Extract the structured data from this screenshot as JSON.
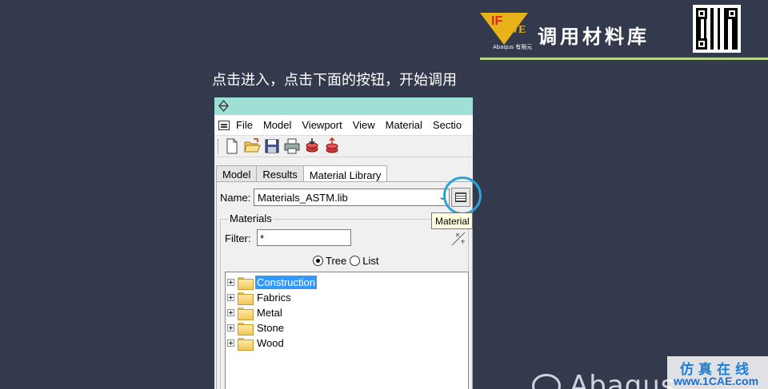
{
  "header": {
    "logo_text_1": "IF",
    "logo_text_2": "WE",
    "logo_sub": "Abaqus 有限元",
    "title": "调用材料库"
  },
  "caption": "点击进入，点击下面的按钮，开始调用",
  "window": {
    "menu": [
      "File",
      "Model",
      "Viewport",
      "View",
      "Material",
      "Sectio"
    ],
    "toolbar_icons": [
      "new-file-icon",
      "open-folder-icon",
      "save-icon",
      "print-icon",
      "import-icon",
      "export-icon"
    ],
    "tabs": [
      {
        "label": "Model",
        "active": false
      },
      {
        "label": "Results",
        "active": false
      },
      {
        "label": "Material Library",
        "active": true
      }
    ],
    "name_label": "Name:",
    "name_value": "Materials_ASTM.lib",
    "tooltip": "Material",
    "materials_label": "Materials",
    "filter_label": "Filter:",
    "filter_value": "*",
    "view_options": {
      "tree": "Tree",
      "list": "List",
      "selected": "Tree"
    },
    "tree_items": [
      {
        "label": "Construction",
        "selected": true
      },
      {
        "label": "Fabrics",
        "selected": false
      },
      {
        "label": "Metal",
        "selected": false
      },
      {
        "label": "Stone",
        "selected": false
      },
      {
        "label": "Wood",
        "selected": false
      }
    ]
  },
  "footer": {
    "brand": "Abaqus",
    "site_top": "仿真在线",
    "site_bottom": "www.1CAE.com"
  },
  "colors": {
    "background": "#333a4d",
    "titlebar": "#9ee0d6",
    "highlight_ring": "#2aa3d9",
    "selection": "#3399ff",
    "header_line": "#b7d68a"
  }
}
